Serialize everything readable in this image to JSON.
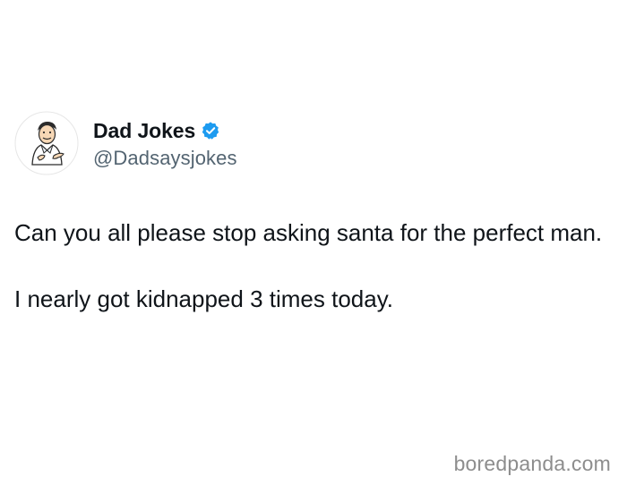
{
  "author": {
    "display_name": "Dad Jokes",
    "handle": "@Dadsaysjokes",
    "avatar_icon": "cartoon-dad-avatar-icon",
    "verified_icon": "verified-badge-icon",
    "verified_color": "#1d9bf0"
  },
  "tweet": {
    "paragraphs": [
      "Can you all please stop asking santa for the perfect man.",
      "I nearly got kidnapped 3 times today."
    ]
  },
  "watermark": {
    "text": "boredpanda.com"
  },
  "colors": {
    "text_primary": "#0f1419",
    "text_secondary": "#536471",
    "watermark": "#8d8d8d",
    "background": "#ffffff"
  }
}
